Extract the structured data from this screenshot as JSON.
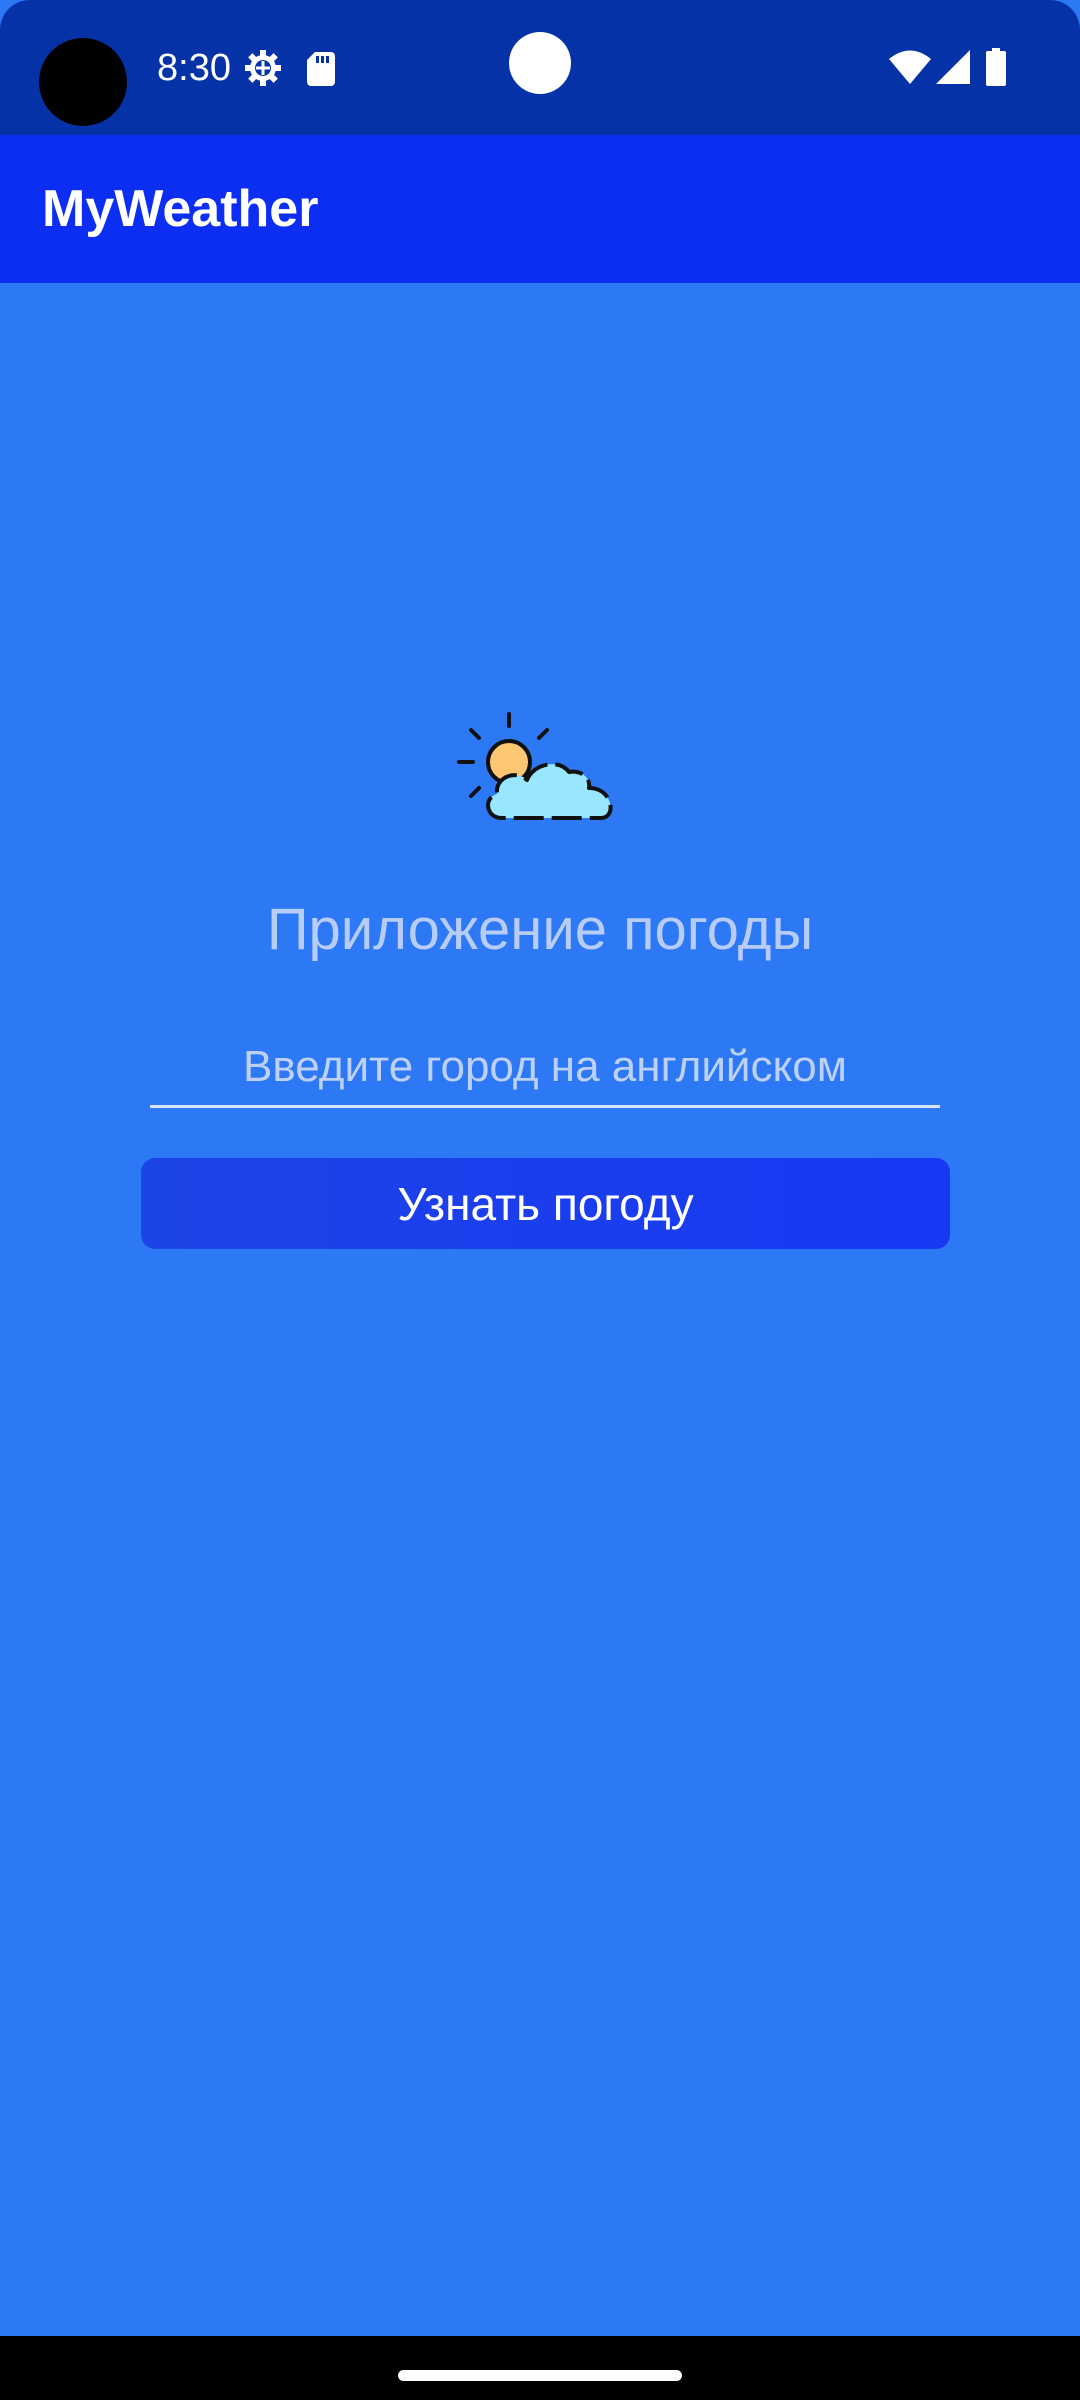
{
  "status_bar": {
    "time": "8:30",
    "icons": [
      "gear-icon",
      "sd-card-icon",
      "wifi-icon",
      "signal-icon",
      "battery-icon"
    ]
  },
  "app_bar": {
    "title": "MyWeather"
  },
  "main": {
    "logo_icon": "sun-cloud-icon",
    "heading": "Приложение погоды",
    "city_input": {
      "value": "",
      "placeholder": "Введите город на английском"
    },
    "get_weather_label": "Узнать погоду"
  },
  "colors": {
    "status_bar": "#0632a8",
    "app_bar": "#0b2ef2",
    "background": "#2d78f5",
    "button": "#1838f4",
    "heading_text": "#b7cdf7"
  }
}
